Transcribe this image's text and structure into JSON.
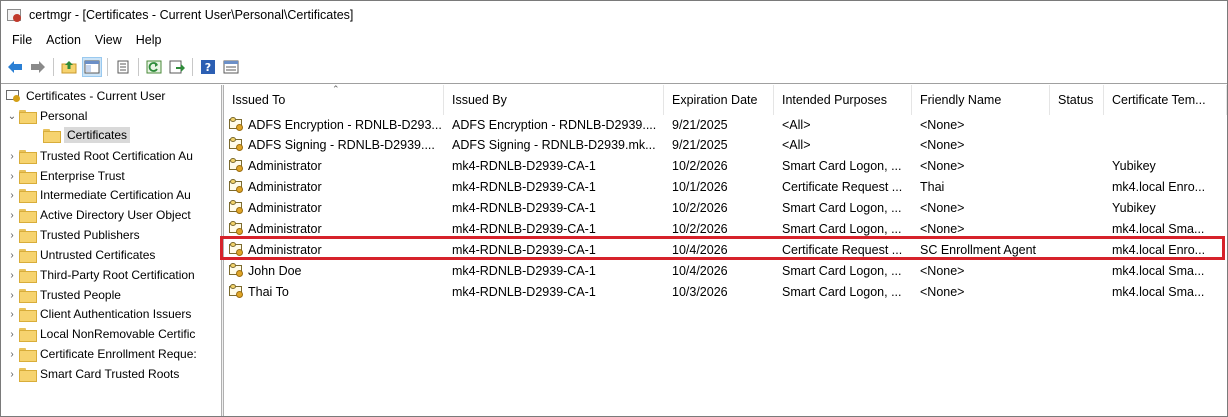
{
  "window": {
    "title": "certmgr - [Certificates - Current User\\Personal\\Certificates]"
  },
  "menu": [
    "File",
    "Action",
    "View",
    "Help"
  ],
  "toolbar": {
    "buttons": [
      "back-arrow-icon",
      "forward-arrow-icon",
      "up-folder-icon",
      "show-hide-tree-icon",
      "properties-icon",
      "refresh-icon",
      "export-list-icon",
      "help-icon",
      "details-view-icon"
    ]
  },
  "tree": {
    "root": "Certificates - Current User",
    "items": [
      {
        "label": "Personal",
        "expanded": true
      },
      {
        "label": "Certificates",
        "selected": true
      },
      {
        "label": "Trusted Root Certification Au"
      },
      {
        "label": "Enterprise Trust"
      },
      {
        "label": "Intermediate Certification Au"
      },
      {
        "label": "Active Directory User Object"
      },
      {
        "label": "Trusted Publishers"
      },
      {
        "label": "Untrusted Certificates"
      },
      {
        "label": "Third-Party Root Certification"
      },
      {
        "label": "Trusted People"
      },
      {
        "label": "Client Authentication Issuers"
      },
      {
        "label": "Local NonRemovable Certific"
      },
      {
        "label": "Certificate Enrollment Reque:"
      },
      {
        "label": "Smart Card Trusted Roots"
      }
    ]
  },
  "list": {
    "columns": [
      "Issued To",
      "Issued By",
      "Expiration Date",
      "Intended Purposes",
      "Friendly Name",
      "Status",
      "Certificate Tem..."
    ],
    "rows": [
      [
        "ADFS Encryption - RDNLB-D293...",
        "ADFS Encryption - RDNLB-D2939....",
        "9/21/2025",
        "<All>",
        "<None>",
        "",
        ""
      ],
      [
        "ADFS Signing - RDNLB-D2939....",
        "ADFS Signing - RDNLB-D2939.mk...",
        "9/21/2025",
        "<All>",
        "<None>",
        "",
        ""
      ],
      [
        "Administrator",
        "mk4-RDNLB-D2939-CA-1",
        "10/2/2026",
        "Smart Card Logon, ...",
        "<None>",
        "",
        "Yubikey"
      ],
      [
        "Administrator",
        "mk4-RDNLB-D2939-CA-1",
        "10/1/2026",
        "Certificate Request ...",
        "Thai",
        "",
        "mk4.local Enro..."
      ],
      [
        "Administrator",
        "mk4-RDNLB-D2939-CA-1",
        "10/2/2026",
        "Smart Card Logon, ...",
        "<None>",
        "",
        "Yubikey"
      ],
      [
        "Administrator",
        "mk4-RDNLB-D2939-CA-1",
        "10/2/2026",
        "Smart Card Logon, ...",
        "<None>",
        "",
        "mk4.local Sma..."
      ],
      [
        "Administrator",
        "mk4-RDNLB-D2939-CA-1",
        "10/4/2026",
        "Certificate Request ...",
        "SC Enrollment Agent",
        "",
        "mk4.local Enro..."
      ],
      [
        "John Doe",
        "mk4-RDNLB-D2939-CA-1",
        "10/4/2026",
        "Smart Card Logon, ...",
        "<None>",
        "",
        "mk4.local Sma..."
      ],
      [
        "Thai To",
        "mk4-RDNLB-D2939-CA-1",
        "10/3/2026",
        "Smart Card Logon, ...",
        "<None>",
        "",
        "mk4.local Sma..."
      ]
    ],
    "highlighted_row": 6
  },
  "colors": {
    "highlight_border": "#d6222a",
    "selection_bg": "#d9d9d9",
    "toolbar_active_bg": "#cce4f7"
  }
}
